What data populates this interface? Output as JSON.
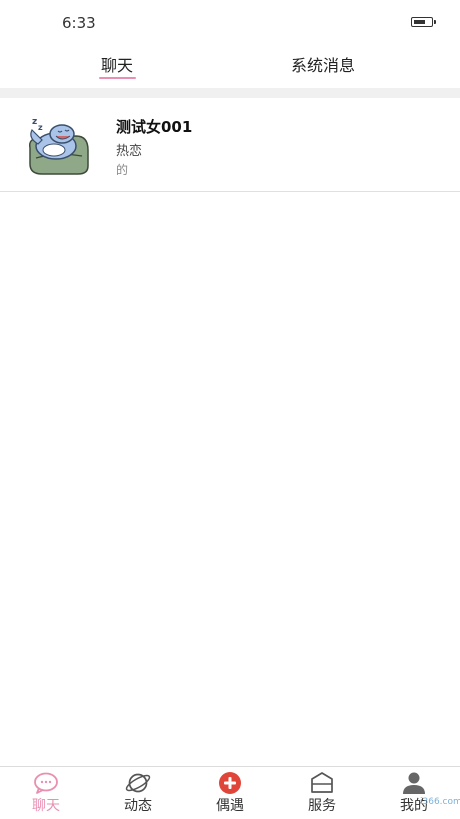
{
  "status_bar": {
    "time": "6:33",
    "battery_level": 0.7
  },
  "top_tabs": [
    {
      "label": "聊天",
      "active": true
    },
    {
      "label": "系统消息",
      "active": false
    }
  ],
  "chat_list": [
    {
      "name": "测试女001",
      "status": "热恋",
      "preview": "的",
      "avatar_icon": "sleeping-dolphin-avatar"
    }
  ],
  "bottom_nav": [
    {
      "label": "聊天",
      "icon": "chat-bubble-icon",
      "active": true
    },
    {
      "label": "动态",
      "icon": "planet-icon",
      "active": false
    },
    {
      "label": "偶遇",
      "icon": "plus-circle-icon",
      "active": false
    },
    {
      "label": "服务",
      "icon": "box-icon",
      "active": false
    },
    {
      "label": "我的",
      "icon": "person-icon",
      "active": false
    }
  ],
  "colors": {
    "accent": "#e98fb2",
    "encounter_red": "#e0453a",
    "icon_gray": "#555555"
  },
  "watermark": "i366.com"
}
